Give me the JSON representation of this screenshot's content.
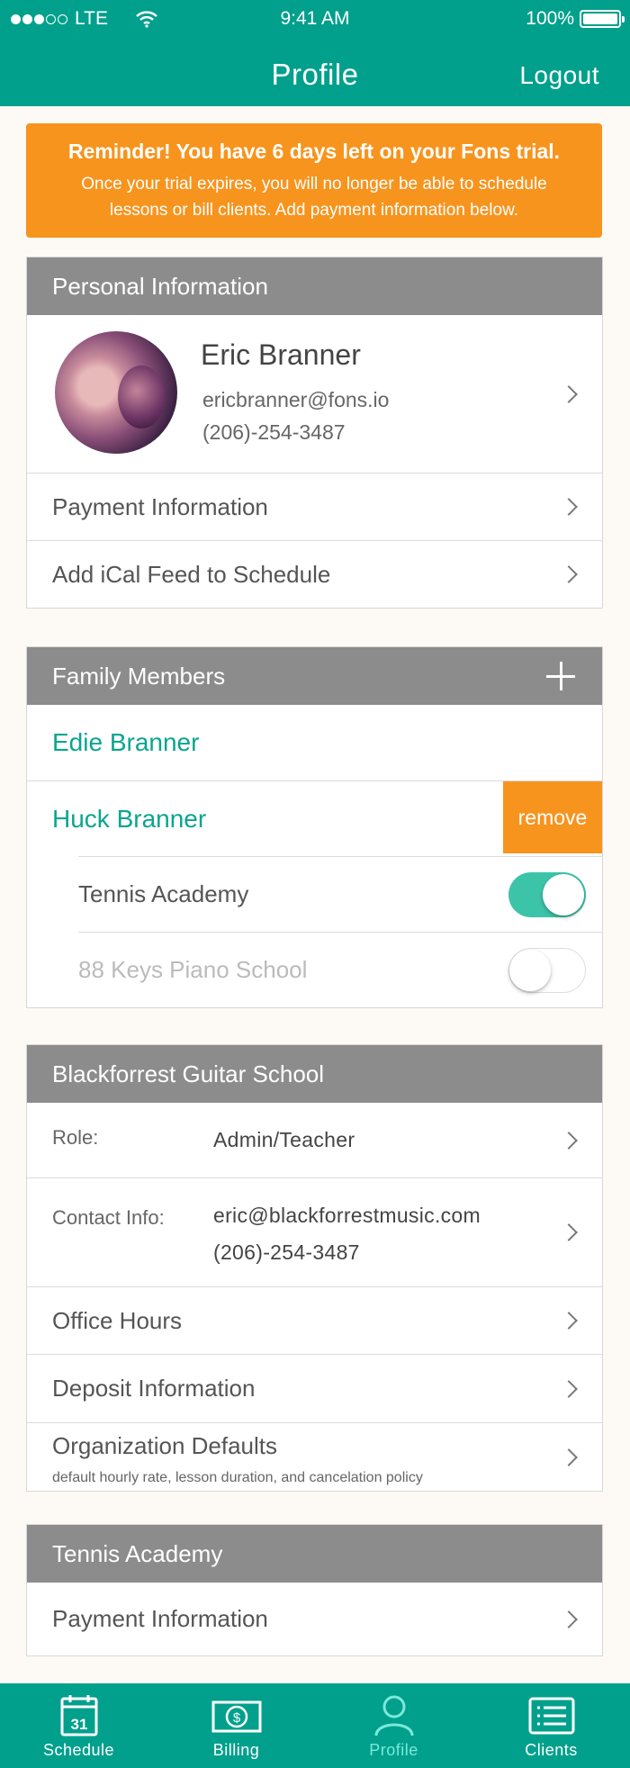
{
  "status_bar": {
    "carrier": "LTE",
    "time": "9:41 AM",
    "battery": "100%"
  },
  "header": {
    "title": "Profile",
    "logout_label": "Logout"
  },
  "reminder": {
    "title": "Reminder! You have 6 days left on your Fons trial.",
    "body_line1": "Once your trial expires, you will no longer be able to schedule",
    "body_line2": "lessons or bill clients. Add payment information below."
  },
  "personal": {
    "heading": "Personal Information",
    "name": "Eric Branner",
    "email": "ericbranner@fons.io",
    "phone": "(206)-254-3487",
    "payment_label": "Payment Information",
    "ical_label": "Add iCal Feed to Schedule"
  },
  "family": {
    "heading": "Family Members",
    "members": [
      "Edie Branner",
      "Huck Branner"
    ],
    "remove_label": "remove",
    "schools": [
      {
        "name": "Tennis Academy",
        "enabled": true
      },
      {
        "name": "88 Keys Piano School",
        "enabled": false
      }
    ]
  },
  "guitar_school": {
    "heading": "Blackforrest Guitar School",
    "role_label": "Role:",
    "role_value": "Admin/Teacher",
    "contact_label": "Contact Info:",
    "contact_email": "eric@blackforrestmusic.com",
    "contact_phone": "(206)-254-3487",
    "office_hours_label": "Office Hours",
    "deposit_label": "Deposit Information",
    "org_defaults_label": "Organization Defaults",
    "org_defaults_caption": "default hourly rate, lesson duration, and cancelation policy"
  },
  "tennis": {
    "heading": "Tennis Academy",
    "payment_label": "Payment Information"
  },
  "tabs": [
    {
      "label": "Schedule",
      "icon": "calendar-icon",
      "calendar_day": "31"
    },
    {
      "label": "Billing",
      "icon": "dollar-bill-icon"
    },
    {
      "label": "Profile",
      "icon": "person-icon",
      "active": true
    },
    {
      "label": "Clients",
      "icon": "list-icon"
    }
  ],
  "colors": {
    "primary": "#01a08c",
    "accent": "#f7941e",
    "section_header": "#8c8c8c",
    "toggle_on": "#3cc4a8",
    "member_name": "#0aa58f"
  }
}
